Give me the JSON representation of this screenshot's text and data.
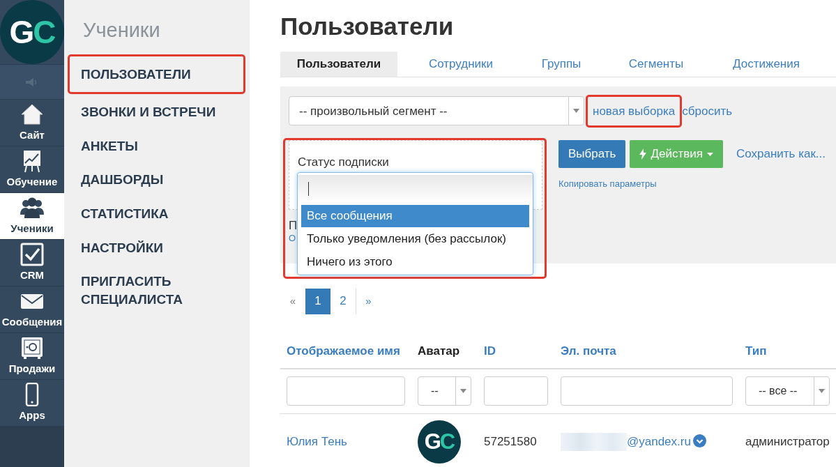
{
  "rail": {
    "logo": "GC",
    "items": [
      {
        "label": "Сайт",
        "kind": "house",
        "selected": false
      },
      {
        "label": "Обучение",
        "kind": "chart",
        "selected": false
      },
      {
        "label": "Ученики",
        "kind": "people",
        "selected": true
      },
      {
        "label": "CRM",
        "kind": "checkbox",
        "selected": false
      },
      {
        "label": "Сообщения",
        "kind": "envelope",
        "selected": false
      },
      {
        "label": "Продажи",
        "kind": "safe",
        "selected": false
      },
      {
        "label": "Apps",
        "kind": "phone",
        "selected": false
      }
    ]
  },
  "sidebar": {
    "title": "Ученики",
    "items": [
      {
        "label": "ПОЛЬЗОВАТЕЛИ",
        "highlighted": true
      },
      {
        "label": "ЗВОНКИ И ВСТРЕЧИ",
        "highlighted": false
      },
      {
        "label": "АНКЕТЫ",
        "highlighted": false
      },
      {
        "label": "ДАШБОРДЫ",
        "highlighted": false
      },
      {
        "label": "СТАТИСТИКА",
        "highlighted": false
      },
      {
        "label": "НАСТРОЙКИ",
        "highlighted": false
      },
      {
        "label": "ПРИГЛАСИТЬ СПЕЦИАЛИСТА",
        "highlighted": false
      }
    ]
  },
  "page": {
    "title": "Пользователи",
    "tabs": [
      {
        "label": "Пользователи",
        "selected": true
      },
      {
        "label": "Сотрудники",
        "selected": false
      },
      {
        "label": "Группы",
        "selected": false
      },
      {
        "label": "Сегменты",
        "selected": false
      },
      {
        "label": "Достижения",
        "selected": false
      }
    ],
    "segment_select": {
      "value": "-- произвольный сегмент --"
    },
    "new_selection_link": {
      "label": "новая выборка",
      "highlighted": true
    },
    "reset_link": {
      "label": "сбросить"
    },
    "filter": {
      "label": "Статус подписки",
      "highlighted": true,
      "hidden_label": "П",
      "hidden_link": "О",
      "options": [
        {
          "label": "Все сообщения",
          "selected": true
        },
        {
          "label": "Только уведомления (без рассылок)",
          "selected": false
        },
        {
          "label": "Ничего из этого",
          "selected": false
        }
      ]
    },
    "select_button": "Выбрать",
    "actions_button": "Действия",
    "save_as_link": "Сохранить как...",
    "copy_params_link": "Копировать параметры",
    "pagination": [
      {
        "label": "«",
        "selected": false
      },
      {
        "label": "1",
        "selected": true
      },
      {
        "label": "2",
        "selected": false
      },
      {
        "label": "»",
        "selected": false
      }
    ],
    "table": {
      "columns": [
        {
          "label": "Отображаемое имя",
          "sortable": true
        },
        {
          "label": "Аватар",
          "sortable": false
        },
        {
          "label": "ID",
          "sortable": true
        },
        {
          "label": "Эл. почта",
          "sortable": true
        },
        {
          "label": "Тип",
          "sortable": true
        }
      ],
      "filters": [
        {
          "kind": "text"
        },
        {
          "kind": "select",
          "value": "--"
        },
        {
          "kind": "text"
        },
        {
          "kind": "text"
        },
        {
          "kind": "select",
          "value": "-- все --"
        }
      ],
      "rows": [
        {
          "name": "Юлия Тень",
          "avatar": "GC",
          "id": "57251580",
          "email": "@yandex.ru",
          "type": "администратор"
        }
      ]
    }
  }
}
